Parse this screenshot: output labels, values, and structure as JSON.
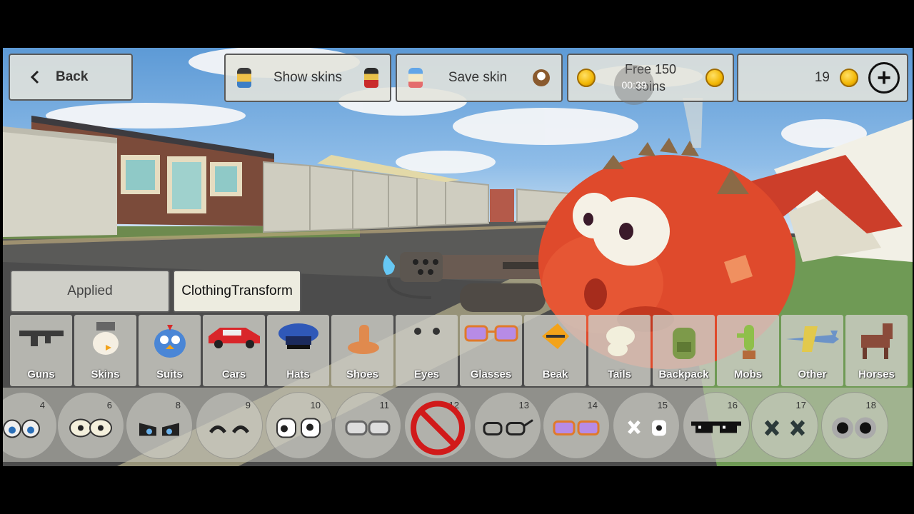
{
  "top_bar": {
    "back_label": "Back",
    "show_skins_label": "Show skins",
    "save_skin_label": "Save skin",
    "free_coins_line1": "Free 150",
    "free_coins_line2": "coins",
    "free_coins_timer": "00:39",
    "coin_balance": "19",
    "add_coins_symbol": "+"
  },
  "tabs": {
    "applied_label": "Applied",
    "clothing_transform_label": "ClothingTransform"
  },
  "categories": [
    {
      "label": "Guns",
      "icon": "gun-icon"
    },
    {
      "label": "Skins",
      "icon": "chicken-skin-icon"
    },
    {
      "label": "Suits",
      "icon": "bird-suit-icon"
    },
    {
      "label": "Cars",
      "icon": "car-icon"
    },
    {
      "label": "Hats",
      "icon": "hat-icon"
    },
    {
      "label": "Shoes",
      "icon": "shoe-icon"
    },
    {
      "label": "Eyes",
      "icon": "eyes-icon"
    },
    {
      "label": "Glasses",
      "icon": "glasses-icon"
    },
    {
      "label": "Beak",
      "icon": "beak-icon"
    },
    {
      "label": "Tails",
      "icon": "tail-icon"
    },
    {
      "label": "Backpack",
      "icon": "backpack-icon"
    },
    {
      "label": "Mobs",
      "icon": "cactus-mob-icon"
    },
    {
      "label": "Other",
      "icon": "plane-icon"
    },
    {
      "label": "Horses",
      "icon": "horse-icon"
    }
  ],
  "eye_items": [
    {
      "num": "4",
      "icon": "cartoon-eyes-icon"
    },
    {
      "num": "6",
      "icon": "round-eyes-icon"
    },
    {
      "num": "8",
      "icon": "angry-eyes-icon"
    },
    {
      "num": "9",
      "icon": "closed-eyes-icon"
    },
    {
      "num": "10",
      "icon": "white-eyes-icon"
    },
    {
      "num": "11",
      "icon": "goggles-icon"
    },
    {
      "num": "12",
      "icon": "none-icon"
    },
    {
      "num": "13",
      "icon": "black-glasses-icon"
    },
    {
      "num": "14",
      "icon": "purple-glasses-icon"
    },
    {
      "num": "15",
      "icon": "x-eyes-icon"
    },
    {
      "num": "16",
      "icon": "pixel-sunglasses-icon"
    },
    {
      "num": "17",
      "icon": "dark-x-eyes-icon"
    },
    {
      "num": "18",
      "icon": "googly-eyes-icon"
    }
  ],
  "colors": {
    "coin": "#f2b705",
    "none_symbol": "#d11a1a",
    "dragon": "#e2482c"
  }
}
